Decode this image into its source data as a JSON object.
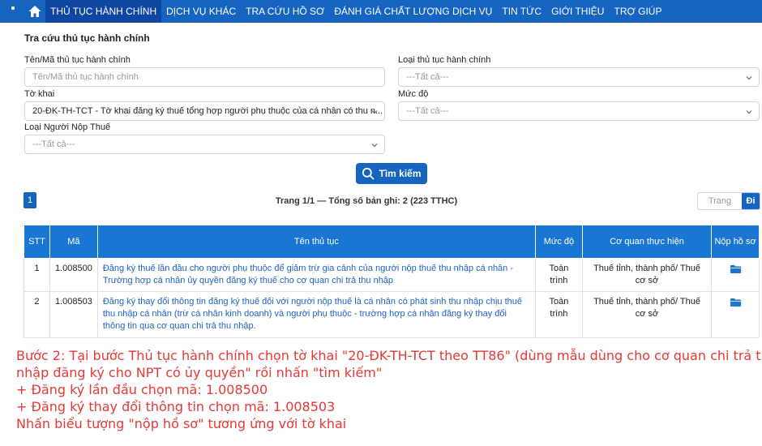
{
  "nav": {
    "items": [
      {
        "label": "THỦ TỤC HÀNH CHÍNH",
        "active": true
      },
      {
        "label": "DỊCH VỤ KHÁC",
        "active": false
      },
      {
        "label": "TRA CỨU HỒ SƠ",
        "active": false
      },
      {
        "label": "ĐÁNH GIÁ CHẤT LƯỢNG DỊCH VỤ",
        "active": false
      },
      {
        "label": "TIN TỨC",
        "active": false
      },
      {
        "label": "GIỚI THIỆU",
        "active": false
      },
      {
        "label": "TRỢ GIÚP",
        "active": false
      }
    ],
    "home_icon": "home-icon",
    "color": "#1565c0"
  },
  "form": {
    "title": "Tra cứu thủ tục hành chính",
    "name_label": "Tên/Mã thủ tục hành chính",
    "name_placeholder": "Tên/Mã thủ tục hành chính",
    "type_label": "Loại thủ tục hành chính",
    "type_value": "---Tất cả---",
    "form_label": "Tờ khai",
    "form_value": "20-ĐK-TH-TCT - Tờ khai đăng ký thuế tổng hợp người phụ thuộc của cá nhân có thu n...",
    "level_label": "Mức độ",
    "level_value": "---Tất cả---",
    "taxpayer_label": "Loại Người Nộp Thuế",
    "taxpayer_value": "---Tất cả---",
    "search_label": "Tìm kiếm"
  },
  "pager": {
    "current_page": "1",
    "summary": "Trang 1/1 — Tổng số bản ghi: 2 (223 TTHC)",
    "goto_placeholder": "Trang",
    "goto_button": "Đi"
  },
  "table": {
    "headers": [
      "STT",
      "Mã",
      "Tên thủ tục",
      "Mức độ",
      "Cơ quan thực hiện",
      "Nộp hồ sơ"
    ],
    "rows": [
      {
        "stt": "1",
        "code": "1.008500",
        "name": "Đăng ký thuế lần đầu cho người phụ thuộc để giảm trừ gia cảnh của người nộp thuế thu nhập cá nhân - Trường hợp cá nhân ủy quyền đăng ký thuế cho cơ quan chi trả thu nhập",
        "level": "Toàn trình",
        "agency": "Thuế tỉnh, thành phố/ Thuế cơ sở",
        "submit_icon": "folder-icon"
      },
      {
        "stt": "2",
        "code": "1.008503",
        "name": "Đăng ký thay đổi thông tin đăng ký thuế đối với người nộp thuế là cá nhân có phát sinh thu nhập chịu thuế thu nhập cá nhân (trừ cá nhân kinh doanh) và người phụ thuộc - trường hợp cá nhân đăng ký thay đổi thông tin qua cơ quan chi trả thu nhập.",
        "level": "Toàn trình",
        "agency": "Thuế tỉnh, thành phố/ Thuế cơ sở",
        "submit_icon": "folder-icon"
      }
    ]
  },
  "instructions": {
    "line1": "Bước 2: Tại bước Thủ tục hành chính chọn tờ khai \"20-ĐK-TH-TCT theo TT86\" (dùng mẫu dùng cho cơ quan chi trả thu",
    "line2": "nhập đăng ký cho NPT có ủy quyền\" rồi nhấn \"tìm kiếm\"",
    "line3": "+ Đăng ký lần đầu chọn mã: 1.008500",
    "line4": "+ Đăng ký thay đổi thông tin chọn mã: 1.008503",
    "line5": "Nhấn biểu tượng \"nộp hồ sơ\" tương ứng với tờ khai",
    "color": "#e53935"
  }
}
